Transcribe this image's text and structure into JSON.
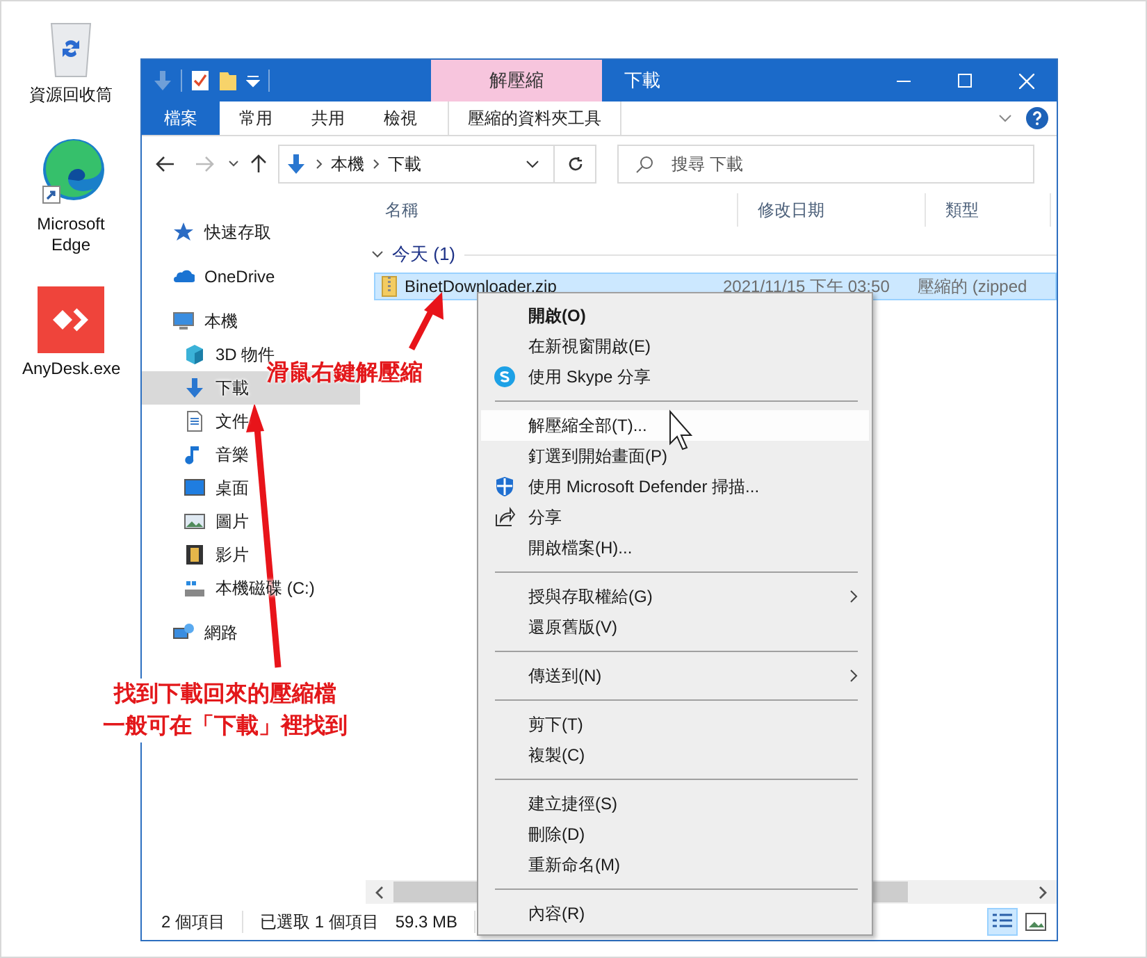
{
  "desktop_icons": [
    {
      "label": "資源回收筒",
      "kind": "recycle"
    },
    {
      "label": "Microsoft Edge",
      "kind": "browser"
    },
    {
      "label": "AnyDesk.exe",
      "kind": "remote"
    }
  ],
  "window": {
    "title": "下載",
    "contextual_tab": "解壓縮"
  },
  "ribbon_tabs": [
    {
      "label": "檔案",
      "kind": "file"
    },
    {
      "label": "常用",
      "kind": "tab"
    },
    {
      "label": "共用",
      "kind": "tab"
    },
    {
      "label": "檢視",
      "kind": "tab"
    },
    {
      "label": "壓縮的資料夾工具",
      "kind": "contextual"
    }
  ],
  "address": {
    "breadcrumb": [
      "本機",
      "下載"
    ]
  },
  "search": {
    "placeholder": "搜尋 下載"
  },
  "navigation": [
    {
      "label": "快速存取",
      "kind": "star",
      "selected": false
    },
    {
      "label": "OneDrive",
      "kind": "cloud",
      "selected": false
    },
    {
      "label": "本機",
      "kind": "pc",
      "selected": false,
      "children": [
        {
          "label": "3D 物件",
          "kind": "cube",
          "selected": false
        },
        {
          "label": "下載",
          "kind": "download",
          "selected": true
        },
        {
          "label": "文件",
          "kind": "doc",
          "selected": false
        },
        {
          "label": "音樂",
          "kind": "music",
          "selected": false
        },
        {
          "label": "桌面",
          "kind": "desktop",
          "selected": false
        },
        {
          "label": "圖片",
          "kind": "picture",
          "selected": false
        },
        {
          "label": "影片",
          "kind": "video",
          "selected": false
        },
        {
          "label": "本機磁碟 (C:)",
          "kind": "drive",
          "selected": false
        }
      ]
    },
    {
      "label": "網路",
      "kind": "network",
      "selected": false
    }
  ],
  "columns": [
    "名稱",
    "修改日期",
    "類型"
  ],
  "groups": [
    {
      "label": "今天 (1)",
      "files": [
        {
          "name": "BinetDownloader.zip",
          "modified": "2021/11/15 下午 03:50",
          "type": "壓縮的 (zipped",
          "selected": true
        }
      ]
    }
  ],
  "context_menu": [
    {
      "kind": "item",
      "label": "開啟(O)",
      "default": true,
      "selected": false,
      "submenu": false
    },
    {
      "kind": "item",
      "label": "在新視窗開啟(E)",
      "default": false,
      "selected": false,
      "submenu": false
    },
    {
      "kind": "skype",
      "label": "使用 Skype 分享",
      "default": false,
      "selected": false,
      "submenu": false
    },
    {
      "kind": "separator"
    },
    {
      "kind": "item",
      "label": "解壓縮全部(T)...",
      "default": false,
      "selected": true,
      "submenu": false
    },
    {
      "kind": "item",
      "label": "釘選到開始畫面(P)",
      "default": false,
      "selected": false,
      "submenu": false
    },
    {
      "kind": "shield",
      "label": "使用 Microsoft Defender 掃描...",
      "default": false,
      "selected": false,
      "submenu": false
    },
    {
      "kind": "share",
      "label": "分享",
      "default": false,
      "selected": false,
      "submenu": false
    },
    {
      "kind": "item",
      "label": "開啟檔案(H)...",
      "default": false,
      "selected": false,
      "submenu": false
    },
    {
      "kind": "separator"
    },
    {
      "kind": "item",
      "label": "授與存取權給(G)",
      "default": false,
      "selected": false,
      "submenu": true
    },
    {
      "kind": "item",
      "label": "還原舊版(V)",
      "default": false,
      "selected": false,
      "submenu": false
    },
    {
      "kind": "separator"
    },
    {
      "kind": "item",
      "label": "傳送到(N)",
      "default": false,
      "selected": false,
      "submenu": true
    },
    {
      "kind": "separator"
    },
    {
      "kind": "item",
      "label": "剪下(T)",
      "default": false,
      "selected": false,
      "submenu": false
    },
    {
      "kind": "item",
      "label": "複製(C)",
      "default": false,
      "selected": false,
      "submenu": false
    },
    {
      "kind": "separator"
    },
    {
      "kind": "item",
      "label": "建立捷徑(S)",
      "default": false,
      "selected": false,
      "submenu": false
    },
    {
      "kind": "item",
      "label": "刪除(D)",
      "default": false,
      "selected": false,
      "submenu": false
    },
    {
      "kind": "item",
      "label": "重新命名(M)",
      "default": false,
      "selected": false,
      "submenu": false
    },
    {
      "kind": "separator"
    },
    {
      "kind": "item",
      "label": "內容(R)",
      "default": false,
      "selected": false,
      "submenu": false
    }
  ],
  "status_bar": {
    "count": "2 個項目",
    "selection": "已選取 1 個項目",
    "size": "59.3 MB"
  },
  "views": [
    {
      "kind": "details",
      "selected": true
    },
    {
      "kind": "tiles",
      "selected": false
    }
  ],
  "annotations": [
    {
      "lines": [
        "滑鼠右鍵解壓縮"
      ]
    },
    {
      "lines": [
        "找到下載回來的壓縮檔",
        "一般可在「下載」裡找到"
      ]
    }
  ]
}
